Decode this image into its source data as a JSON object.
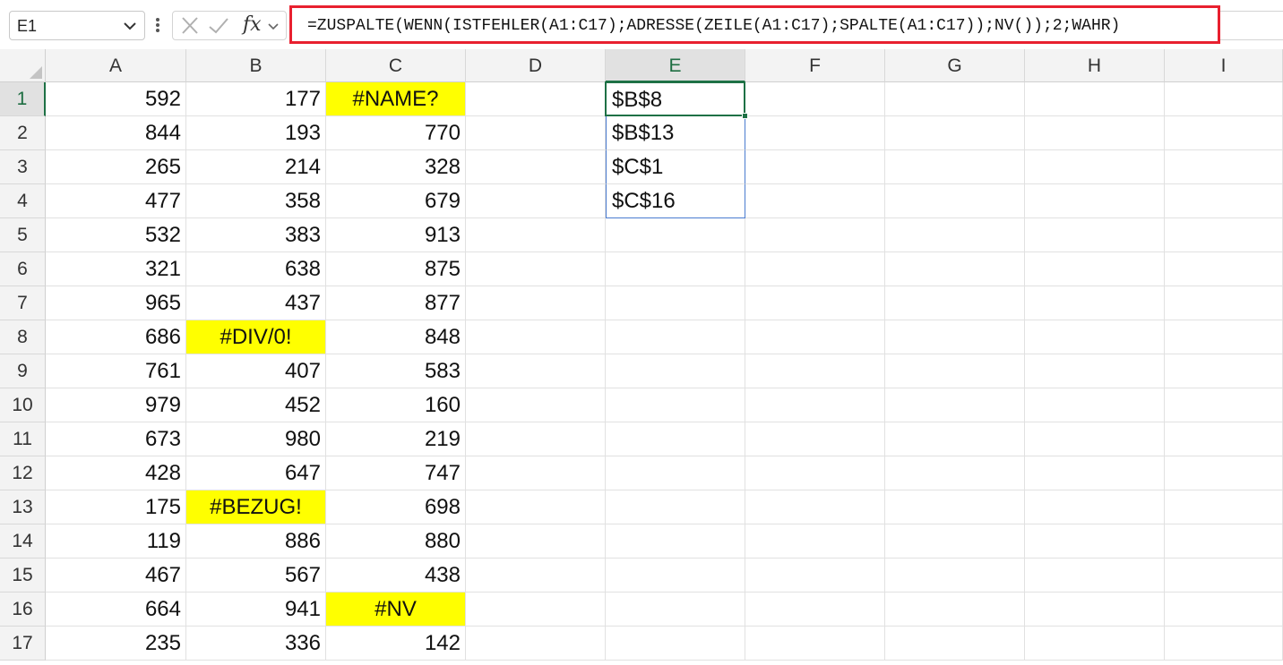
{
  "name_box": {
    "value": "E1"
  },
  "formula_bar": {
    "formula": "=ZUSPALTE(WENN(ISTFEHLER(A1:C17);ADRESSE(ZEILE(A1:C17);SPALTE(A1:C17));NV());2;WAHR)",
    "highlight_color": "#e8202f"
  },
  "icons": [
    "chevron-down-icon",
    "more-vertical-icon",
    "cancel-x-icon",
    "confirm-check-icon",
    "fx-function-icon"
  ],
  "fx_label": "fx",
  "columns": [
    "A",
    "B",
    "C",
    "D",
    "E",
    "F",
    "G",
    "H",
    "I"
  ],
  "active_column": "E",
  "active_row": 1,
  "rows": [
    {
      "n": "1",
      "A": "592",
      "B": "177",
      "C": "#NAME?",
      "E": "$B$8"
    },
    {
      "n": "2",
      "A": "844",
      "B": "193",
      "C": "770",
      "E": "$B$13"
    },
    {
      "n": "3",
      "A": "265",
      "B": "214",
      "C": "328",
      "E": "$C$1"
    },
    {
      "n": "4",
      "A": "477",
      "B": "358",
      "C": "679",
      "E": "$C$16"
    },
    {
      "n": "5",
      "A": "532",
      "B": "383",
      "C": "913",
      "E": ""
    },
    {
      "n": "6",
      "A": "321",
      "B": "638",
      "C": "875",
      "E": ""
    },
    {
      "n": "7",
      "A": "965",
      "B": "437",
      "C": "877",
      "E": ""
    },
    {
      "n": "8",
      "A": "686",
      "B": "#DIV/0!",
      "C": "848",
      "E": ""
    },
    {
      "n": "9",
      "A": "761",
      "B": "407",
      "C": "583",
      "E": ""
    },
    {
      "n": "10",
      "A": "979",
      "B": "452",
      "C": "160",
      "E": ""
    },
    {
      "n": "11",
      "A": "673",
      "B": "980",
      "C": "219",
      "E": ""
    },
    {
      "n": "12",
      "A": "428",
      "B": "647",
      "C": "747",
      "E": ""
    },
    {
      "n": "13",
      "A": "175",
      "B": "#BEZUG!",
      "C": "698",
      "E": ""
    },
    {
      "n": "14",
      "A": "119",
      "B": "886",
      "C": "880",
      "E": ""
    },
    {
      "n": "15",
      "A": "467",
      "B": "567",
      "C": "438",
      "E": ""
    },
    {
      "n": "16",
      "A": "664",
      "B": "941",
      "C": "#NV",
      "E": ""
    },
    {
      "n": "17",
      "A": "235",
      "B": "336",
      "C": "142",
      "E": ""
    }
  ],
  "error_cell_fill": "#ffff00",
  "selection_color": "#1e7145",
  "spill_border_color": "#4a7bd0"
}
